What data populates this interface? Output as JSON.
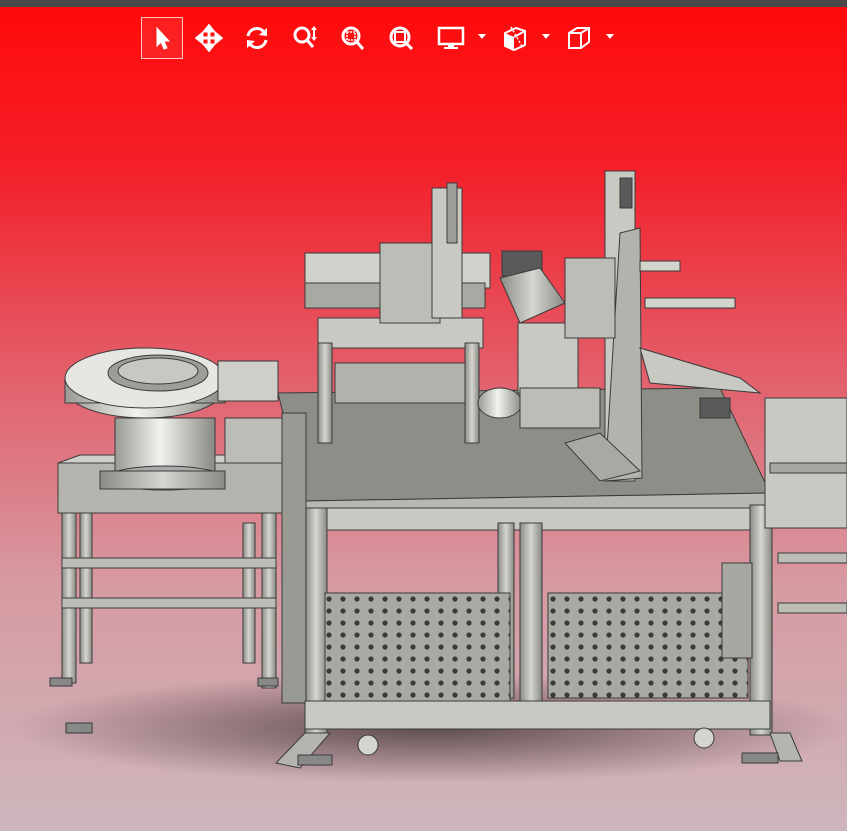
{
  "app": {
    "title": "",
    "colors": {
      "topbar": "#4a4a4a",
      "background_top": "#ff0a0a",
      "background_bottom": "#cdb6bc",
      "toolbar_icon": "#ffffff",
      "machine_metal": "#b8b8b2",
      "machine_dark": "#4a4a4a"
    }
  },
  "toolbar": {
    "tools": [
      {
        "name": "select",
        "icon": "pointer-arrow-icon",
        "active": true
      },
      {
        "name": "pan",
        "icon": "move-arrows-icon",
        "active": false
      },
      {
        "name": "rotate",
        "icon": "rotate-icon",
        "active": false
      },
      {
        "name": "zoom",
        "icon": "zoom-updown-icon",
        "active": false
      },
      {
        "name": "zoom-window",
        "icon": "zoom-window-icon",
        "active": false
      },
      {
        "name": "zoom-fit",
        "icon": "zoom-fit-icon",
        "active": false
      },
      {
        "name": "display-mode",
        "icon": "monitor-icon",
        "active": false,
        "dropdown": true
      },
      {
        "name": "section-view",
        "icon": "section-cube-icon",
        "active": false,
        "dropdown": true
      },
      {
        "name": "view-orientation",
        "icon": "cube-icon",
        "active": false,
        "dropdown": true
      }
    ]
  },
  "viewport": {
    "model": "machine-assembly-3d"
  }
}
